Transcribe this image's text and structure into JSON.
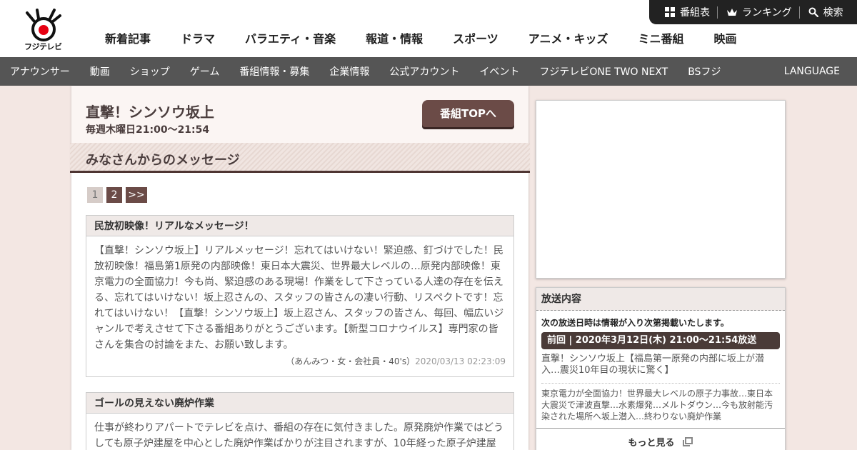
{
  "header": {
    "logo_text": "フジテレビ",
    "utility": {
      "program_guide": "番組表",
      "ranking": "ランキング",
      "search": "検索"
    },
    "main_nav": [
      "新着記事",
      "ドラマ",
      "バラエティ・音楽",
      "報道・情報",
      "スポーツ",
      "アニメ・キッズ",
      "ミニ番組",
      "映画"
    ]
  },
  "subnav": {
    "items": [
      "アナウンサー",
      "動画",
      "ショップ",
      "ゲーム",
      "番組情報・募集",
      "企業情報",
      "公式アカウント",
      "イベント",
      "フジテレビONE TWO NEXT",
      "BSフジ"
    ],
    "language": "LANGUAGE"
  },
  "program": {
    "title": "直撃！シンソウ坂上",
    "schedule": "毎週木曜日21:00～21:54",
    "top_button": "番組TOPへ"
  },
  "section": {
    "title": "みなさんからのメッセージ"
  },
  "pager": {
    "current": "1",
    "page2": "2",
    "next": ">>"
  },
  "messages": [
    {
      "title": "民放初映像！リアルなメッセージ！",
      "body": "【直撃！シンソウ坂上】リアルメッセージ！忘れてはいけない！緊迫感、釘づけでした！民放初映像！福島第1原発の内部映像！東日本大震災、世界最大レベルの…原発内部映像！東京電力の全面協力！今も尚、緊迫感のある現場！作業をして下さっている人達の存在を伝える、忘れてはいけない！坂上忍さんの、スタッフの皆さんの凄い行動、リスペクトです！忘れてはいけない！【直撃！シンソウ坂上】坂上忍さん、スタッフの皆さん、毎回、幅広いジャンルで考えさせて下さる番組ありがとうございます。【新型コロナウイルス】専門家の皆さんを集合の討論をまた、お願い致します。",
      "author": "（あんみつ・女・会社員・40's）",
      "date": "2020/03/13 02:23:09"
    },
    {
      "title": "ゴールの見えない廃炉作業",
      "body": "仕事が終わりアパートでテレビを点け、番組の存在に気付きました。原発廃炉作業ではどうしても原子炉建屋を中心とした廃炉作業ばかりが注目されますが、10年経った原子炉建屋"
    }
  ],
  "broadcast": {
    "title": "放送内容",
    "note": "次の放送日時は情報が入り次第掲載いたします。",
    "previous": "前回 | 2020年3月12日(木) 21:00～21:54放送",
    "episode_title": "直撃！シンソウ坂上【福島第一原発の内部に坂上が潜入…震災10年目の現状に驚く】",
    "episode_desc": "東京電力が全面協力！世界最大レベルの原子力事故…東日本大震災で津波直撃…水素爆発…メルトダウン…今も放射能汚染された場所へ坂上潜入…終わりない廃炉作業",
    "more": "もっと見る"
  }
}
